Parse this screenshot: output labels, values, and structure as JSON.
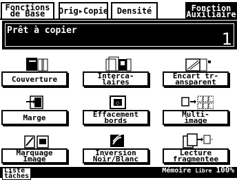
{
  "tabs": [
    {
      "label": "Fonctions\nde Base",
      "active": false
    },
    {
      "label": "Orig▸Copie",
      "active": false
    },
    {
      "label": "Densité",
      "active": false
    },
    {
      "label": "Fonction\nAuxiliaire",
      "active": true
    }
  ],
  "status": {
    "text": "Prêt à copier",
    "count": "1"
  },
  "functions": [
    {
      "label": "Couverture",
      "icon": "cover-icon"
    },
    {
      "label": "Interca-\nlaires",
      "icon": "insert-sheets-icon"
    },
    {
      "label": "Encart tr-\nansparent",
      "icon": "transparency-insert-icon"
    },
    {
      "label": "Marge",
      "icon": "margin-icon"
    },
    {
      "label": "Effacement\nbords",
      "icon": "edge-erase-icon"
    },
    {
      "label": "Multi-\nimage",
      "icon": "multi-image-icon"
    },
    {
      "label": "Marquage\nImage",
      "icon": "image-stamp-icon"
    },
    {
      "label": "Inversion\nNoir/Blanc",
      "icon": "black-white-reverse-icon"
    },
    {
      "label": "Lecture\nfragmentee",
      "icon": "separate-scan-icon"
    }
  ],
  "footer": {
    "left_label": "Liste\ntâches",
    "memory_label": "Mémoire",
    "memory_sub": "Libre",
    "memory_value": "100%"
  }
}
